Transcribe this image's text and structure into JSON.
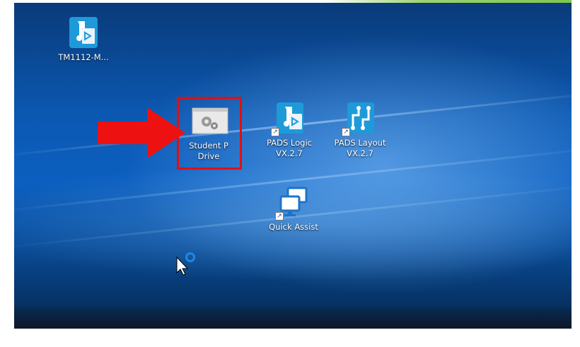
{
  "desktop": {
    "icons": [
      {
        "label": "TM1112-M..."
      },
      {
        "label": "Student P\nDrive"
      },
      {
        "label": "PADS Logic\nVX.2.7"
      },
      {
        "label": "PADS Layout\nVX.2.7"
      },
      {
        "label": "Quick Assist"
      }
    ]
  },
  "colors": {
    "highlight": "#e01010",
    "pads_blue": "#1f9ad8"
  }
}
